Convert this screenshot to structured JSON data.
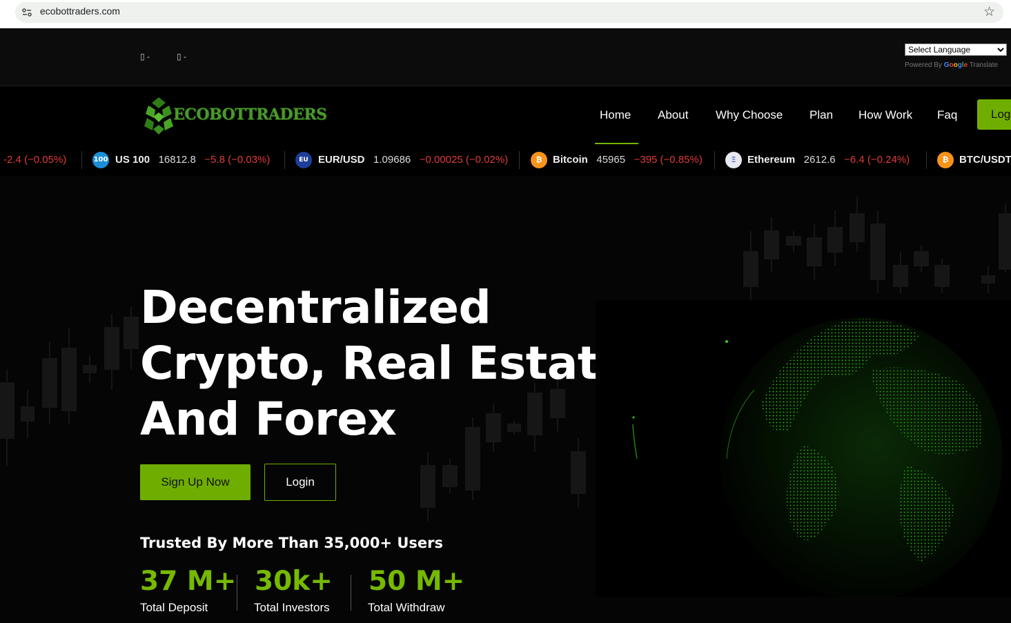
{
  "browser": {
    "url": "ecobottraders.com"
  },
  "topbar": {
    "contact1": "▯ -",
    "contact2": "▯ -",
    "language_select": "Select Language",
    "powered_by": "Powered By",
    "google": "Google",
    "translate": "Translate"
  },
  "nav": {
    "logo_text": "ECOBOTTRADERS",
    "items": [
      "Home",
      "About",
      "Why Choose",
      "Plan",
      "How Work",
      "Faq"
    ],
    "login": "Log"
  },
  "ticker": [
    {
      "name": "",
      "price": "",
      "change": "-2.4 (−0.05%)"
    },
    {
      "icon": "100",
      "name": "US 100",
      "price": "16812.8",
      "change": "−5.8 (−0.03%)"
    },
    {
      "icon": "EU",
      "name": "EUR/USD",
      "price": "1.09686",
      "change": "−0.00025 (−0.02%)"
    },
    {
      "icon": "₿",
      "name": "Bitcoin",
      "price": "45965",
      "change": "−395 (−0.85%)"
    },
    {
      "icon": "Ξ",
      "name": "Ethereum",
      "price": "2612.6",
      "change": "−6.4 (−0.24%)"
    },
    {
      "icon": "₿",
      "name": "BTC/USDT",
      "price": "",
      "change": ""
    }
  ],
  "hero": {
    "title_line1": "Decentralized",
    "title_line2": "Crypto, Real Estate,",
    "title_line3": "And Forex",
    "signup": "Sign Up Now",
    "login": "Login",
    "trusted": "Trusted By More Than 35,000+ Users",
    "stats": [
      {
        "value": "37 M+",
        "label": "Total Deposit"
      },
      {
        "value": "30k+",
        "label": "Total Investors"
      },
      {
        "value": "50 M+",
        "label": "Total Withdraw"
      }
    ]
  },
  "colors": {
    "accent": "#6fae00",
    "negative": "#e03b3b",
    "background": "#000000"
  }
}
